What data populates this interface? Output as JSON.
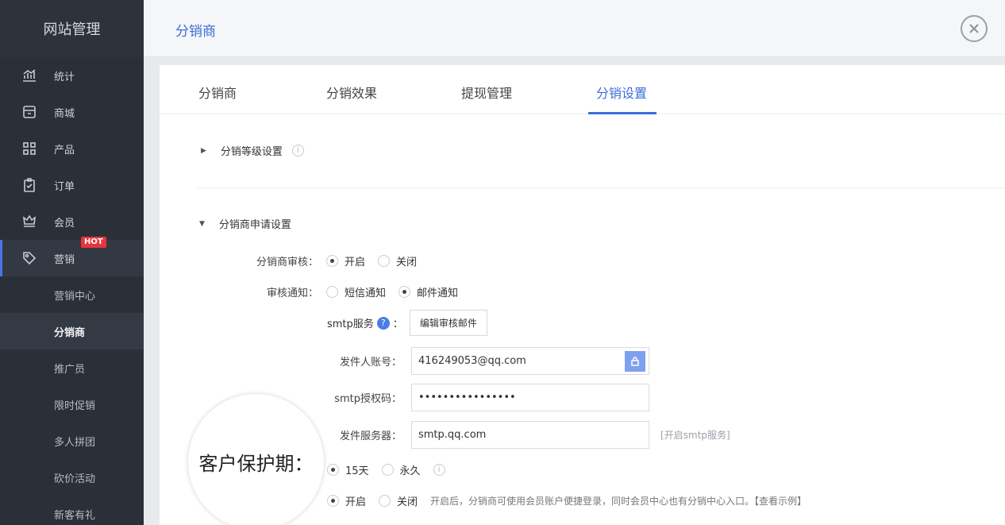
{
  "sidebar": {
    "title": "网站管理",
    "items": [
      {
        "label": "统计",
        "icon": "stats-icon"
      },
      {
        "label": "商城",
        "icon": "store-icon"
      },
      {
        "label": "产品",
        "icon": "grid-icon"
      },
      {
        "label": "订单",
        "icon": "order-icon"
      },
      {
        "label": "会员",
        "icon": "crown-icon"
      },
      {
        "label": "营销",
        "icon": "tag-icon",
        "badge": "HOT"
      }
    ],
    "sub_items": [
      "营销中心",
      "分销商",
      "推广员",
      "限时促销",
      "多人拼团",
      "砍价活动",
      "新客有礼"
    ]
  },
  "header": {
    "title": "分销商"
  },
  "tabs": [
    "分销商",
    "分销效果",
    "提现管理",
    "分销设置"
  ],
  "active_tab": "分销设置",
  "sections": {
    "level": {
      "title": "分销等级设置",
      "info": "i"
    },
    "apply": {
      "title": "分销商申请设置"
    }
  },
  "form": {
    "review": {
      "label": "分销商审核：",
      "options": [
        "开启",
        "关闭"
      ],
      "selected": "开启"
    },
    "notify": {
      "label": "审核通知：",
      "options": [
        "短信通知",
        "邮件通知"
      ],
      "selected": "邮件通知"
    },
    "smtp": {
      "label": "smtp服务",
      "colon": "：",
      "help": "?",
      "button": "编辑审核邮件"
    },
    "sender": {
      "label": "发件人账号：",
      "value": "416249053@qq.com"
    },
    "auth": {
      "label": "smtp授权码：",
      "value": "••••••••••••••••"
    },
    "server": {
      "label": "发件服务器：",
      "value": "smtp.qq.com",
      "hint": "[开启smtp服务]"
    },
    "protect": {
      "options": [
        "15天",
        "永久"
      ],
      "selected": "15天",
      "info": "i"
    },
    "login": {
      "options": [
        "开启",
        "关闭"
      ],
      "selected": "开启",
      "hint": "开启后，分销商可使用会员账户便捷登录，同时会员中心也有分销中心入口。【查看示例】"
    }
  },
  "magnifier": {
    "text": "客户保护期："
  },
  "colors": {
    "accent": "#3a6fd8",
    "sidebar": "#2b3038",
    "hot": "#e8353a"
  }
}
